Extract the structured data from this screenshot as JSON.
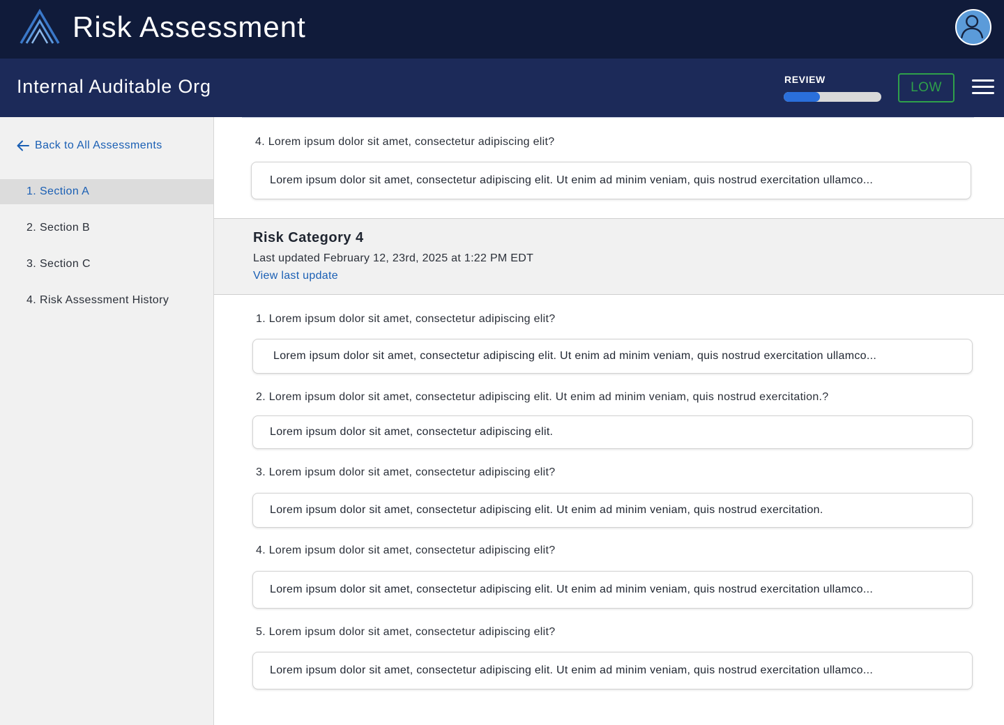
{
  "header": {
    "app_title": "Risk Assessment",
    "logo_icon": "chevron-peak-logo",
    "avatar_icon": "user-avatar-icon"
  },
  "subheader": {
    "org_name": "Internal Auditable Org",
    "review_label": "REVIEW",
    "review_progress": 0.37,
    "risk_level": "LOW",
    "menu_icon": "hamburger-menu-icon"
  },
  "sidebar": {
    "back_link": "Back to All Assessments",
    "items": [
      {
        "label": "1. Section A",
        "active": true
      },
      {
        "label": "2. Section  B",
        "active": false
      },
      {
        "label": "3. Section C",
        "active": false
      },
      {
        "label": "4. Risk Assessment History",
        "active": false
      }
    ]
  },
  "previous_section": {
    "question": "4. Lorem ipsum dolor sit amet, consectetur adipiscing elit?",
    "answer": "Lorem ipsum dolor sit amet, consectetur adipiscing elit. Ut enim ad minim veniam, quis nostrud exercitation ullamco..."
  },
  "category": {
    "title": "Risk Category 4",
    "last_updated": "Last updated February 12, 23rd, 2025 at 1:22 PM EDT",
    "view_link": "View last update"
  },
  "questions": [
    {
      "question": "1. Lorem ipsum dolor sit amet, consectetur adipiscing elit?",
      "answer": "Lorem ipsum dolor sit amet, consectetur adipiscing elit. Ut enim ad minim veniam, quis nostrud exercitation ullamco..."
    },
    {
      "question": "2. Lorem ipsum dolor sit amet, consectetur adipiscing elit. Ut enim ad minim veniam, quis nostrud exercitation.?",
      "answer": "Lorem ipsum dolor sit amet, consectetur adipiscing elit."
    },
    {
      "question": "3. Lorem ipsum dolor sit amet, consectetur adipiscing elit?",
      "answer": "Lorem ipsum dolor sit amet, consectetur adipiscing elit. Ut enim ad minim veniam, quis nostrud exercitation."
    },
    {
      "question": "4. Lorem ipsum dolor sit amet, consectetur adipiscing elit?",
      "answer": "Lorem ipsum dolor sit amet, consectetur adipiscing elit. Ut enim ad minim veniam, quis nostrud exercitation ullamco..."
    },
    {
      "question": "5. Lorem ipsum dolor sit amet, consectetur adipiscing elit?",
      "answer": "Lorem ipsum dolor sit amet, consectetur adipiscing elit. Ut enim ad minim veniam, quis nostrud exercitation ullamco..."
    }
  ],
  "colors": {
    "top_bar": "#101b3a",
    "sub_bar": "#1c2a59",
    "accent_blue": "#1a5fb4",
    "progress_blue": "#2a6fdb",
    "risk_low_green": "#2fa04a"
  }
}
